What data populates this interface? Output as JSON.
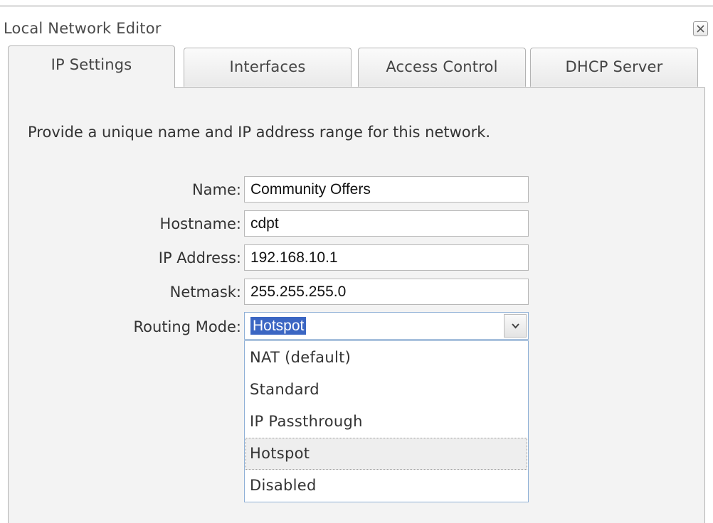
{
  "window": {
    "title": "Local Network Editor",
    "close_icon": "close-x-icon"
  },
  "tabs": [
    {
      "label": "IP Settings",
      "active": true
    },
    {
      "label": "Interfaces",
      "active": false
    },
    {
      "label": "Access Control",
      "active": false
    },
    {
      "label": "DHCP Server",
      "active": false
    }
  ],
  "ip_settings": {
    "instructions": "Provide a unique name and IP address range for this network.",
    "name": {
      "label": "Name:",
      "value": "Community Offers"
    },
    "hostname": {
      "label": "Hostname:",
      "value": "cdpt"
    },
    "ip_address": {
      "label": "IP Address:",
      "value": "192.168.10.1"
    },
    "netmask": {
      "label": "Netmask:",
      "value": "255.255.255.0"
    },
    "routing_mode": {
      "label": "Routing Mode:",
      "value": "Hotspot",
      "options": [
        "NAT (default)",
        "Standard",
        "IP Passthrough",
        "Hotspot",
        "Disabled"
      ],
      "highlighted_option": "Hotspot"
    }
  },
  "colors": {
    "selection": "#3b66c3",
    "panel_bg": "#f3f3f3",
    "focus_border": "#8fb0d6"
  }
}
